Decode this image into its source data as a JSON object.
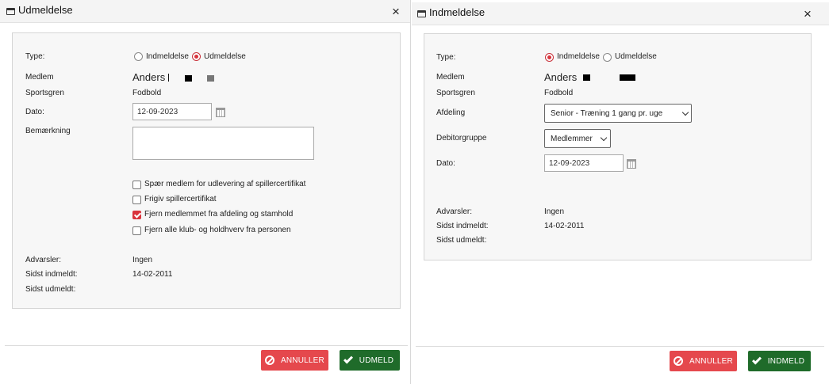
{
  "left": {
    "title": "Udmeldelse",
    "close": "×",
    "type_label": "Type:",
    "type_options": [
      "Indmeldelse",
      "Udmeldelse"
    ],
    "selected_type": "Udmeldelse",
    "member_label": "Medlem",
    "member_value": "Anders",
    "sport_label": "Sportsgren",
    "sport_value": "Fodbold",
    "date_label": "Dato:",
    "date_value": "12-09-2023",
    "remark_label": "Bemærkning",
    "remark_value": "",
    "checkboxes": [
      {
        "label": "Spær medlem for udlevering af spillercertifikat",
        "checked": false
      },
      {
        "label": "Frigiv spillercertifikat",
        "checked": false
      },
      {
        "label": "Fjern medlemmet fra afdeling og stamhold",
        "checked": true
      },
      {
        "label": "Fjern alle klub- og holdhverv fra personen",
        "checked": false
      }
    ],
    "warnings_label": "Advarsler:",
    "warnings_value": "Ingen",
    "last_in_label": "Sidst indmeldt:",
    "last_in_value": "14-02-2011",
    "last_out_label": "Sidst udmeldt:",
    "last_out_value": "",
    "cancel_label": "ANNULLER",
    "confirm_label": "UDMELD"
  },
  "right": {
    "title": "Indmeldelse",
    "close": "×",
    "type_label": "Type:",
    "type_options": [
      "Indmeldelse",
      "Udmeldelse"
    ],
    "selected_type": "Indmeldelse",
    "member_label": "Medlem",
    "member_value": "Anders",
    "sport_label": "Sportsgren",
    "sport_value": "Fodbold",
    "department_label": "Afdeling",
    "department_value": "Senior - Træning 1 gang pr. uge",
    "debtor_label": "Debitorgruppe",
    "debtor_value": "Medlemmer",
    "date_label": "Dato:",
    "date_value": "12-09-2023",
    "warnings_label": "Advarsler:",
    "warnings_value": "Ingen",
    "last_in_label": "Sidst indmeldt:",
    "last_in_value": "14-02-2011",
    "last_out_label": "Sidst udmeldt:",
    "last_out_value": "",
    "cancel_label": "ANNULLER",
    "confirm_label": "INDMELD"
  },
  "colors": {
    "accent_red": "#d9333c",
    "cancel_button": "#e5484d",
    "confirm_button": "#1f6b2a"
  },
  "icons": [
    "window-icon",
    "close-icon",
    "calendar-icon",
    "ban-icon",
    "check-icon",
    "chevron-down-icon"
  ]
}
